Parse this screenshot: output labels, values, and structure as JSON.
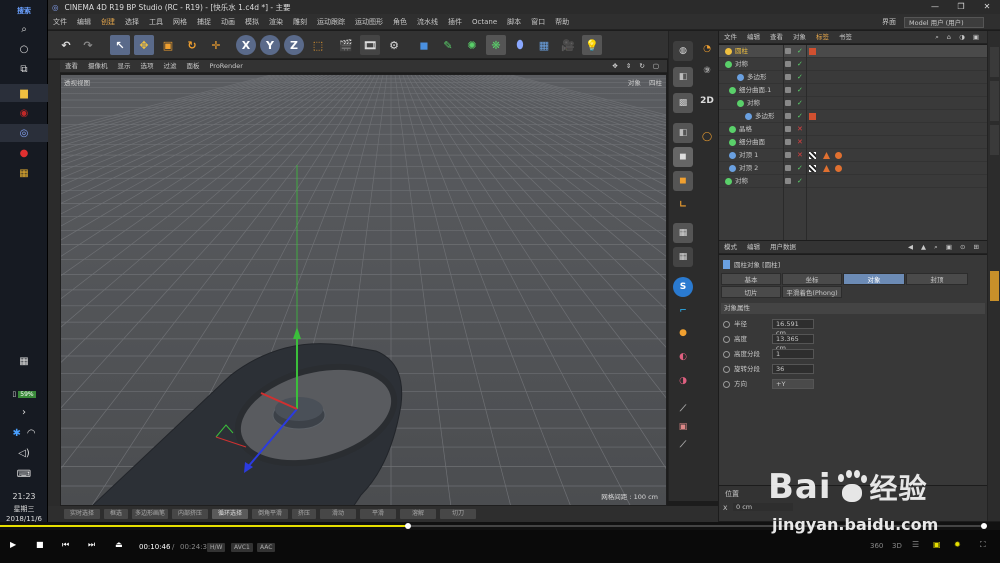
{
  "taskbar": {
    "search": "搜索",
    "battery": "59%",
    "time": "21:23",
    "weekday": "星期三",
    "date": "2018/11/6"
  },
  "window": {
    "title_prefix": "CINEMA 4D R19 BP Studio (RC - R19) - [",
    "title": "快乐水 1.c4d *",
    "title_suffix": "] - 主要",
    "controls": [
      "—",
      "❐",
      "✕"
    ]
  },
  "menubar": {
    "items": [
      "文件",
      "编辑",
      "创建",
      "选择",
      "工具",
      "网格",
      "捕捉",
      "动画",
      "模拟",
      "渲染",
      "雕刻",
      "运动跟踪",
      "运动图形",
      "角色",
      "流水线",
      "插件",
      "Octane",
      "脚本",
      "窗口",
      "帮助"
    ],
    "layout_label": "界面",
    "layout_value": "Model 用户 (用户)"
  },
  "toolbar": {
    "axis_x": "X",
    "axis_y": "Y",
    "axis_z": "Z"
  },
  "viewport": {
    "menu": [
      "查看",
      "摄像机",
      "显示",
      "选项",
      "过滤",
      "面板",
      "ProRender"
    ],
    "label": "透视视图",
    "grid_spacing": "网格间距 : 100 cm",
    "tools_right": [
      "对象",
      "四柱"
    ]
  },
  "timeline_buttons": [
    "实时选择",
    "框选",
    "多边形画笔",
    "内部挤压",
    "循环选择",
    "倒角平滑",
    "挤压",
    "滑动",
    "平滑",
    "溶解",
    "切刀"
  ],
  "object_manager": {
    "menu": [
      "文件",
      "编辑",
      "查看",
      "对象",
      "标签",
      "书签"
    ],
    "rows": [
      {
        "name": "圆柱",
        "color": "#f0c040"
      },
      {
        "name": "对称",
        "color": "#5ad06a"
      },
      {
        "name": "多边形",
        "color": "#6aa0e0"
      },
      {
        "name": "细分曲面.1",
        "color": "#5ad06a"
      },
      {
        "name": "对称",
        "color": "#5ad06a"
      },
      {
        "name": "多边形",
        "color": "#6aa0e0"
      },
      {
        "name": "晶格",
        "color": "#5ad06a"
      },
      {
        "name": "细分曲面",
        "color": "#5ad06a"
      },
      {
        "name": "对顶 1",
        "color": "#6aa0e0"
      },
      {
        "name": "对顶 2",
        "color": "#6aa0e0"
      },
      {
        "name": "对称",
        "color": "#5ad06a"
      }
    ]
  },
  "attribute_manager": {
    "menu": [
      "模式",
      "编辑",
      "用户数据"
    ],
    "object_title": "圆柱对象 [圆柱]",
    "tabs": [
      "基本",
      "坐标",
      "对象",
      "封顶",
      "切片",
      "平滑着色(Phong)"
    ],
    "section": "对象属性",
    "params": [
      {
        "label": "半径",
        "value": "16.591 cm"
      },
      {
        "label": "高度",
        "value": "13.365 cm"
      },
      {
        "label": "高度分段",
        "value": "1"
      },
      {
        "label": "旋转分段",
        "value": "36"
      },
      {
        "label": "方向",
        "value": "+Y"
      }
    ]
  },
  "coordinates": {
    "header": "位置",
    "x_label": "X",
    "x_value": "0 cm"
  },
  "player": {
    "current": "00:10:46",
    "separator": "/",
    "total": "00:24:33",
    "badges": [
      "H/W",
      "AVC1",
      "AAC"
    ],
    "right_icons": [
      "360",
      "3D"
    ]
  },
  "watermark": {
    "brand": "Bai",
    "brand2": "经验",
    "url": "jingyan.baidu.com"
  }
}
